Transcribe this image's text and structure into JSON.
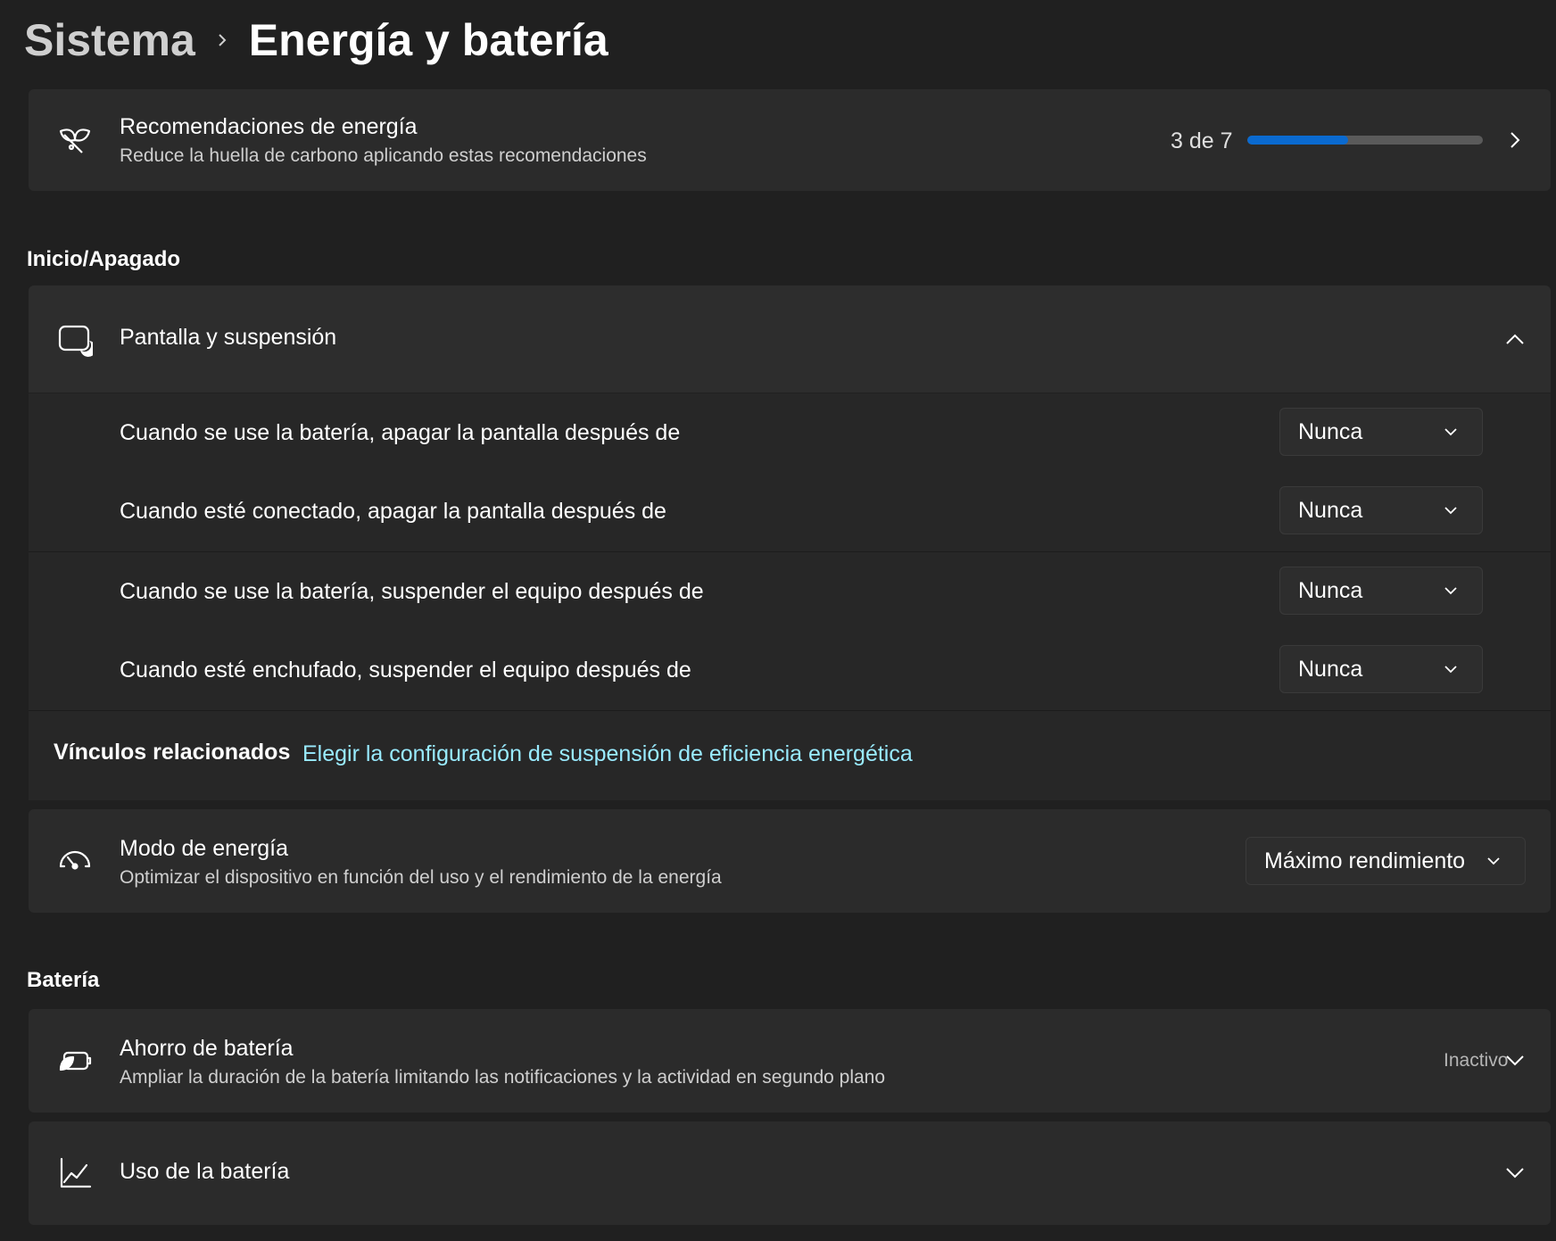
{
  "breadcrumb": {
    "parent": "Sistema",
    "current": "Energía y batería"
  },
  "recommendations": {
    "title": "Recomendaciones de energía",
    "subtitle": "Reduce la huella de carbono aplicando estas recomendaciones",
    "progress_text": "3 de 7",
    "progress_value": 0.428,
    "progress_color": "#0a6ad0",
    "icon": "leaf-icon"
  },
  "sections": {
    "power": "Inicio/Apagado",
    "battery": "Batería"
  },
  "screen_sleep": {
    "title": "Pantalla y suspensión",
    "icon": "screen-sleep-icon",
    "settings": [
      {
        "label": "Cuando se use la batería, apagar la pantalla después de",
        "value": "Nunca"
      },
      {
        "label": "Cuando esté conectado, apagar la pantalla después de",
        "value": "Nunca"
      },
      {
        "label": "Cuando se use la batería, suspender el equipo después de",
        "value": "Nunca"
      },
      {
        "label": "Cuando esté enchufado, suspender el equipo después de",
        "value": "Nunca"
      }
    ]
  },
  "related_links": {
    "label": "Vínculos relacionados",
    "link": "Elegir la configuración de suspensión de eficiencia energética",
    "link_color": "#99ebff"
  },
  "power_mode": {
    "title": "Modo de energía",
    "subtitle": "Optimizar el dispositivo en función del uso y el rendimiento de la energía",
    "value": "Máximo rendimiento",
    "icon": "gauge-icon"
  },
  "battery_saver": {
    "title": "Ahorro de batería",
    "subtitle": "Ampliar la duración de la batería limitando las notificaciones y la actividad en segundo plano",
    "status": "Inactivo",
    "icon": "battery-saver-icon"
  },
  "battery_usage": {
    "title": "Uso de la batería",
    "icon": "chart-icon"
  }
}
